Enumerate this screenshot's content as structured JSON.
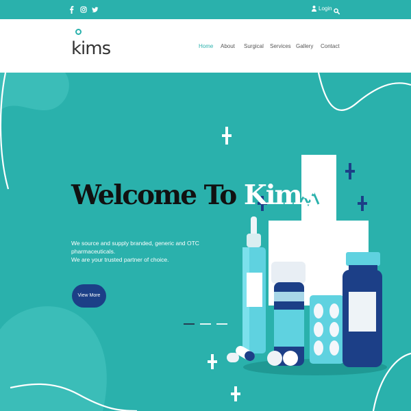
{
  "topbar": {
    "social_icons": [
      "facebook-icon",
      "instagram-icon",
      "twitter-icon"
    ],
    "login_label": "Login",
    "search_icon": "search-icon"
  },
  "brand": {
    "logo_text": "kims"
  },
  "nav": {
    "items": [
      "Home",
      "About",
      "Surgical",
      "Services",
      "Gallery",
      "Contact"
    ],
    "active": "Home"
  },
  "hero": {
    "title_main": "Welcome To",
    "title_accent": "Kims",
    "description_line1": "We source and supply branded, generic and OTC pharmaceuticals.",
    "description_line2": "We are your trusted partner of choice.",
    "button_label": "View More",
    "slides_count": 3,
    "active_slide": 1
  },
  "colors": {
    "teal": "#2ab1ac",
    "navy": "#1c3f87",
    "white": "#ffffff"
  }
}
